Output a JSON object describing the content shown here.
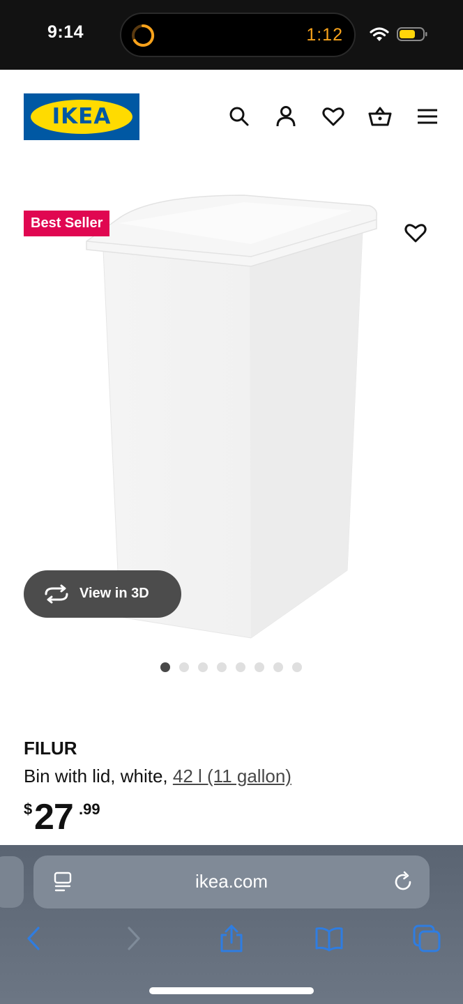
{
  "status_bar": {
    "time": "9:14",
    "timer": "1:12",
    "timer_color": "#f7a21b"
  },
  "header": {
    "logo_text": "IKEA",
    "brand_blue": "#0058a3",
    "brand_yellow": "#ffdb00",
    "icons": [
      "search-icon",
      "account-icon",
      "favorites-icon",
      "cart-icon",
      "menu-icon"
    ]
  },
  "product_media": {
    "badge": "Best Seller",
    "badge_color": "#e00751",
    "view_3d_label": "View in 3D",
    "image_count": 8,
    "active_image_index": 0
  },
  "product": {
    "name": "FILUR",
    "description": "Bin with lid, white, ",
    "size_link": "42 l (11 gallon)",
    "price_currency": "$",
    "price_integer": "27",
    "price_decimal": ".99"
  },
  "browser": {
    "url": "ikea.com",
    "toolbar": [
      "back-icon",
      "forward-icon",
      "share-icon",
      "bookmarks-icon",
      "tabs-icon"
    ],
    "accent": "#2f7de1"
  }
}
